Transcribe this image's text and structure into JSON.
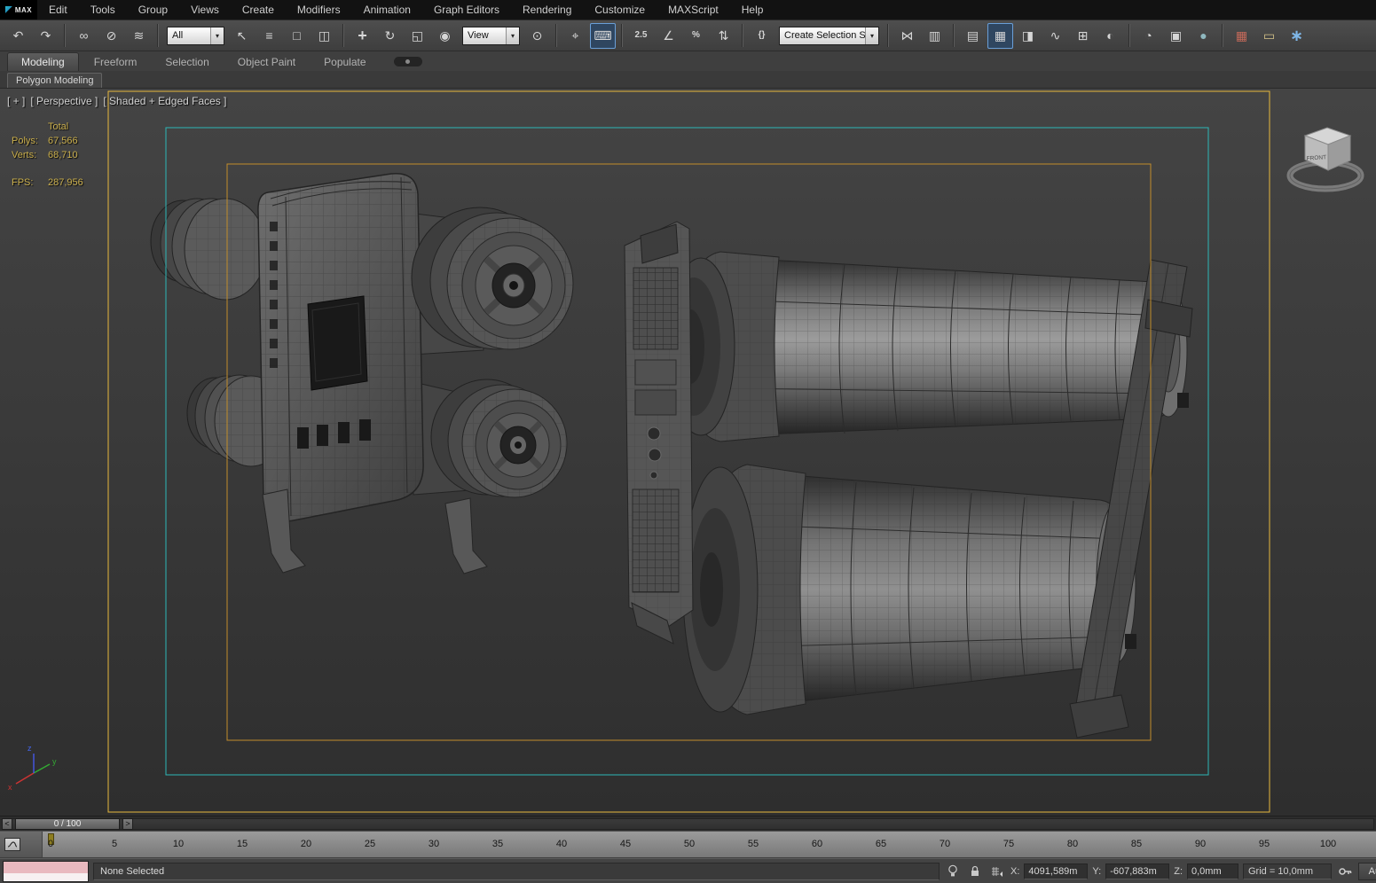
{
  "app": {
    "logo_text": "MAX"
  },
  "icons": {
    "chevron_down": "▾"
  },
  "colors": {
    "safe_frame_outer": "#e7b83d",
    "safe_frame_action": "#2cb7b7",
    "safe_frame_title": "#c28d2b",
    "active_button_border": "#6a9fd8",
    "listener_pink": "#e9b9bf",
    "stats_text": "#c9ae4c"
  },
  "menubar": {
    "items": [
      "Edit",
      "Tools",
      "Group",
      "Views",
      "Create",
      "Modifiers",
      "Animation",
      "Graph Editors",
      "Rendering",
      "Customize",
      "MAXScript",
      "Help"
    ]
  },
  "toolbar": {
    "items": [
      {
        "t": "btn",
        "name": "undo-button",
        "icon": "undo-icon",
        "g": "↶"
      },
      {
        "t": "btn",
        "name": "redo-button",
        "icon": "redo-icon",
        "g": "↷"
      },
      {
        "t": "sep"
      },
      {
        "t": "btn",
        "name": "select-and-link-button",
        "icon": "link-icon",
        "g": "∞"
      },
      {
        "t": "btn",
        "name": "unlink-selection-button",
        "icon": "unlink-icon",
        "g": "⊘"
      },
      {
        "t": "btn",
        "name": "bind-to-space-warp-button",
        "icon": "space-warp-icon",
        "g": "≋"
      },
      {
        "t": "sep"
      },
      {
        "t": "select",
        "name": "selection-filter-dropdown",
        "value": "All"
      },
      {
        "t": "btn",
        "name": "select-object-button",
        "icon": "select-cursor-icon",
        "g": "↖"
      },
      {
        "t": "btn",
        "name": "select-by-name-button",
        "icon": "select-by-name-icon",
        "g": "≡"
      },
      {
        "t": "btn",
        "name": "rectangular-selection-region-button",
        "icon": "rect-region-icon",
        "g": "□"
      },
      {
        "t": "btn",
        "name": "window-crossing-toggle",
        "icon": "window-crossing-icon",
        "g": "◫"
      },
      {
        "t": "sep"
      },
      {
        "t": "btn",
        "name": "select-and-move-button",
        "icon": "move-icon",
        "g": "+",
        "big": true
      },
      {
        "t": "btn",
        "name": "select-and-rotate-button",
        "icon": "rotate-icon",
        "g": "↻"
      },
      {
        "t": "btn",
        "name": "select-and-scale-button",
        "icon": "scale-icon",
        "g": "◱"
      },
      {
        "t": "btn",
        "name": "select-and-place-button",
        "icon": "place-icon",
        "g": "◉"
      },
      {
        "t": "select",
        "name": "reference-coordinate-system-dropdown",
        "value": "View"
      },
      {
        "t": "btn",
        "name": "use-pivot-point-center-button",
        "icon": "pivot-center-icon",
        "g": "⊙"
      },
      {
        "t": "sep"
      },
      {
        "t": "btn",
        "name": "select-and-manipulate-button",
        "icon": "manipulate-icon",
        "g": "⌖"
      },
      {
        "t": "btn",
        "name": "keyboard-shortcut-override-toggle",
        "icon": "keyboard-icon",
        "g": "⌨",
        "active": true
      },
      {
        "t": "sep"
      },
      {
        "t": "btn",
        "name": "snaps-toggle",
        "icon": "snap-25-icon",
        "g": "2.5",
        "text": true
      },
      {
        "t": "btn",
        "name": "angle-snap-toggle",
        "icon": "angle-snap-icon",
        "g": "∠"
      },
      {
        "t": "btn",
        "name": "percent-snap-toggle",
        "icon": "percent-snap-icon",
        "g": "%",
        "text": true
      },
      {
        "t": "btn",
        "name": "spinner-snap-toggle",
        "icon": "spinner-snap-icon",
        "g": "⇅"
      },
      {
        "t": "sep"
      },
      {
        "t": "btn",
        "name": "edit-named-selection-sets-button",
        "icon": "named-sets-icon",
        "g": "{}",
        "text": true
      },
      {
        "t": "select",
        "name": "named-selection-sets-dropdown",
        "value": "Create Selection Se",
        "wide": true
      },
      {
        "t": "sep"
      },
      {
        "t": "btn",
        "name": "mirror-button",
        "icon": "mirror-icon",
        "g": "⋈"
      },
      {
        "t": "btn",
        "name": "align-button",
        "icon": "align-icon",
        "g": "▥"
      },
      {
        "t": "sep"
      },
      {
        "t": "btn",
        "name": "layer-manager-button",
        "icon": "layers-icon",
        "g": "▤"
      },
      {
        "t": "btn",
        "name": "ribbon-toggle-button",
        "icon": "ribbon-icon",
        "g": "▦",
        "active": true
      },
      {
        "t": "btn",
        "name": "scene-explorer-button",
        "icon": "scene-explorer-icon",
        "g": "◨"
      },
      {
        "t": "btn",
        "name": "curve-editor-button",
        "icon": "curve-editor-icon",
        "g": "∿"
      },
      {
        "t": "btn",
        "name": "schematic-view-button",
        "icon": "schematic-view-icon",
        "g": "⊞"
      },
      {
        "t": "btn",
        "name": "material-editor-button",
        "icon": "material-editor-icon",
        "g": "◐"
      },
      {
        "t": "sep"
      },
      {
        "t": "btn",
        "name": "render-setup-button",
        "icon": "render-setup-icon",
        "g": "◔"
      },
      {
        "t": "btn",
        "name": "rendered-frame-window-button",
        "icon": "rendered-frame-icon",
        "g": "▣"
      },
      {
        "t": "btn",
        "name": "render-production-button",
        "icon": "render-teapot-icon",
        "g": "●",
        "color": "#8fb8bf"
      },
      {
        "t": "sep"
      },
      {
        "t": "btn",
        "name": "render-in-cloud-button",
        "icon": "cloud-render-icon",
        "g": "▦",
        "color": "#c66a5a"
      },
      {
        "t": "btn",
        "name": "measure-tool-button",
        "icon": "measure-icon",
        "g": "▭",
        "color": "#d6c489"
      },
      {
        "t": "btn",
        "name": "a360-render-button",
        "icon": "a360-atoms-icon",
        "g": "∗",
        "color": "#7fb7e8",
        "big": true
      }
    ]
  },
  "ribbon": {
    "tabs": [
      {
        "label": "Modeling",
        "active": true
      },
      {
        "label": "Freeform"
      },
      {
        "label": "Selection"
      },
      {
        "label": "Object Paint"
      },
      {
        "label": "Populate"
      }
    ],
    "subtab": "Polygon Modeling"
  },
  "viewport": {
    "label": {
      "plus": "[ + ]",
      "view": "[ Perspective ]",
      "shading": "[ Shaded + Edged Faces ]"
    },
    "stats": {
      "total_label": "Total",
      "polys_label": "Polys:",
      "polys_value": "67,566",
      "verts_label": "Verts:",
      "verts_value": "68,710",
      "fps_label": "FPS:",
      "fps_value": "287,956"
    },
    "viewcube": {
      "front_label": "FRONT"
    },
    "axis": {
      "x": "x",
      "y": "y",
      "z": "z"
    }
  },
  "timeline": {
    "prev_label": "<",
    "frame_display": "0 / 100",
    "next_label": ">"
  },
  "ruler": {
    "ticks": [
      "0",
      "5",
      "10",
      "15",
      "20",
      "25",
      "30",
      "35",
      "40",
      "45",
      "50",
      "55",
      "60",
      "65",
      "70",
      "75",
      "80",
      "85",
      "90",
      "95",
      "100"
    ]
  },
  "statusbar": {
    "prompt": "None Selected",
    "x_label": "X:",
    "x_value": "4091,589m",
    "y_label": "Y:",
    "y_value": "-607,883m",
    "z_label": "Z:",
    "z_value": "0,0mm",
    "grid_value": "Grid = 10,0mm",
    "autokey_label": "Auto"
  }
}
